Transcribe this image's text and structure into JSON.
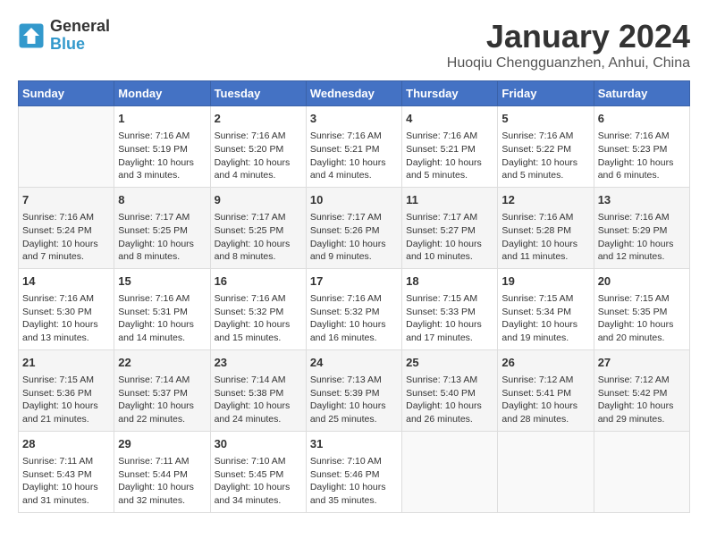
{
  "header": {
    "title": "January 2024",
    "subtitle": "Huoqiu Chengguanzhen, Anhui, China",
    "logo_general": "General",
    "logo_blue": "Blue"
  },
  "days_of_week": [
    "Sunday",
    "Monday",
    "Tuesday",
    "Wednesday",
    "Thursday",
    "Friday",
    "Saturday"
  ],
  "weeks": [
    [
      {
        "day": "",
        "info": ""
      },
      {
        "day": "1",
        "info": "Sunrise: 7:16 AM\nSunset: 5:19 PM\nDaylight: 10 hours\nand 3 minutes."
      },
      {
        "day": "2",
        "info": "Sunrise: 7:16 AM\nSunset: 5:20 PM\nDaylight: 10 hours\nand 4 minutes."
      },
      {
        "day": "3",
        "info": "Sunrise: 7:16 AM\nSunset: 5:21 PM\nDaylight: 10 hours\nand 4 minutes."
      },
      {
        "day": "4",
        "info": "Sunrise: 7:16 AM\nSunset: 5:21 PM\nDaylight: 10 hours\nand 5 minutes."
      },
      {
        "day": "5",
        "info": "Sunrise: 7:16 AM\nSunset: 5:22 PM\nDaylight: 10 hours\nand 5 minutes."
      },
      {
        "day": "6",
        "info": "Sunrise: 7:16 AM\nSunset: 5:23 PM\nDaylight: 10 hours\nand 6 minutes."
      }
    ],
    [
      {
        "day": "7",
        "info": "Sunrise: 7:16 AM\nSunset: 5:24 PM\nDaylight: 10 hours\nand 7 minutes."
      },
      {
        "day": "8",
        "info": "Sunrise: 7:17 AM\nSunset: 5:25 PM\nDaylight: 10 hours\nand 8 minutes."
      },
      {
        "day": "9",
        "info": "Sunrise: 7:17 AM\nSunset: 5:25 PM\nDaylight: 10 hours\nand 8 minutes."
      },
      {
        "day": "10",
        "info": "Sunrise: 7:17 AM\nSunset: 5:26 PM\nDaylight: 10 hours\nand 9 minutes."
      },
      {
        "day": "11",
        "info": "Sunrise: 7:17 AM\nSunset: 5:27 PM\nDaylight: 10 hours\nand 10 minutes."
      },
      {
        "day": "12",
        "info": "Sunrise: 7:16 AM\nSunset: 5:28 PM\nDaylight: 10 hours\nand 11 minutes."
      },
      {
        "day": "13",
        "info": "Sunrise: 7:16 AM\nSunset: 5:29 PM\nDaylight: 10 hours\nand 12 minutes."
      }
    ],
    [
      {
        "day": "14",
        "info": "Sunrise: 7:16 AM\nSunset: 5:30 PM\nDaylight: 10 hours\nand 13 minutes."
      },
      {
        "day": "15",
        "info": "Sunrise: 7:16 AM\nSunset: 5:31 PM\nDaylight: 10 hours\nand 14 minutes."
      },
      {
        "day": "16",
        "info": "Sunrise: 7:16 AM\nSunset: 5:32 PM\nDaylight: 10 hours\nand 15 minutes."
      },
      {
        "day": "17",
        "info": "Sunrise: 7:16 AM\nSunset: 5:32 PM\nDaylight: 10 hours\nand 16 minutes."
      },
      {
        "day": "18",
        "info": "Sunrise: 7:15 AM\nSunset: 5:33 PM\nDaylight: 10 hours\nand 17 minutes."
      },
      {
        "day": "19",
        "info": "Sunrise: 7:15 AM\nSunset: 5:34 PM\nDaylight: 10 hours\nand 19 minutes."
      },
      {
        "day": "20",
        "info": "Sunrise: 7:15 AM\nSunset: 5:35 PM\nDaylight: 10 hours\nand 20 minutes."
      }
    ],
    [
      {
        "day": "21",
        "info": "Sunrise: 7:15 AM\nSunset: 5:36 PM\nDaylight: 10 hours\nand 21 minutes."
      },
      {
        "day": "22",
        "info": "Sunrise: 7:14 AM\nSunset: 5:37 PM\nDaylight: 10 hours\nand 22 minutes."
      },
      {
        "day": "23",
        "info": "Sunrise: 7:14 AM\nSunset: 5:38 PM\nDaylight: 10 hours\nand 24 minutes."
      },
      {
        "day": "24",
        "info": "Sunrise: 7:13 AM\nSunset: 5:39 PM\nDaylight: 10 hours\nand 25 minutes."
      },
      {
        "day": "25",
        "info": "Sunrise: 7:13 AM\nSunset: 5:40 PM\nDaylight: 10 hours\nand 26 minutes."
      },
      {
        "day": "26",
        "info": "Sunrise: 7:12 AM\nSunset: 5:41 PM\nDaylight: 10 hours\nand 28 minutes."
      },
      {
        "day": "27",
        "info": "Sunrise: 7:12 AM\nSunset: 5:42 PM\nDaylight: 10 hours\nand 29 minutes."
      }
    ],
    [
      {
        "day": "28",
        "info": "Sunrise: 7:11 AM\nSunset: 5:43 PM\nDaylight: 10 hours\nand 31 minutes."
      },
      {
        "day": "29",
        "info": "Sunrise: 7:11 AM\nSunset: 5:44 PM\nDaylight: 10 hours\nand 32 minutes."
      },
      {
        "day": "30",
        "info": "Sunrise: 7:10 AM\nSunset: 5:45 PM\nDaylight: 10 hours\nand 34 minutes."
      },
      {
        "day": "31",
        "info": "Sunrise: 7:10 AM\nSunset: 5:46 PM\nDaylight: 10 hours\nand 35 minutes."
      },
      {
        "day": "",
        "info": ""
      },
      {
        "day": "",
        "info": ""
      },
      {
        "day": "",
        "info": ""
      }
    ]
  ]
}
